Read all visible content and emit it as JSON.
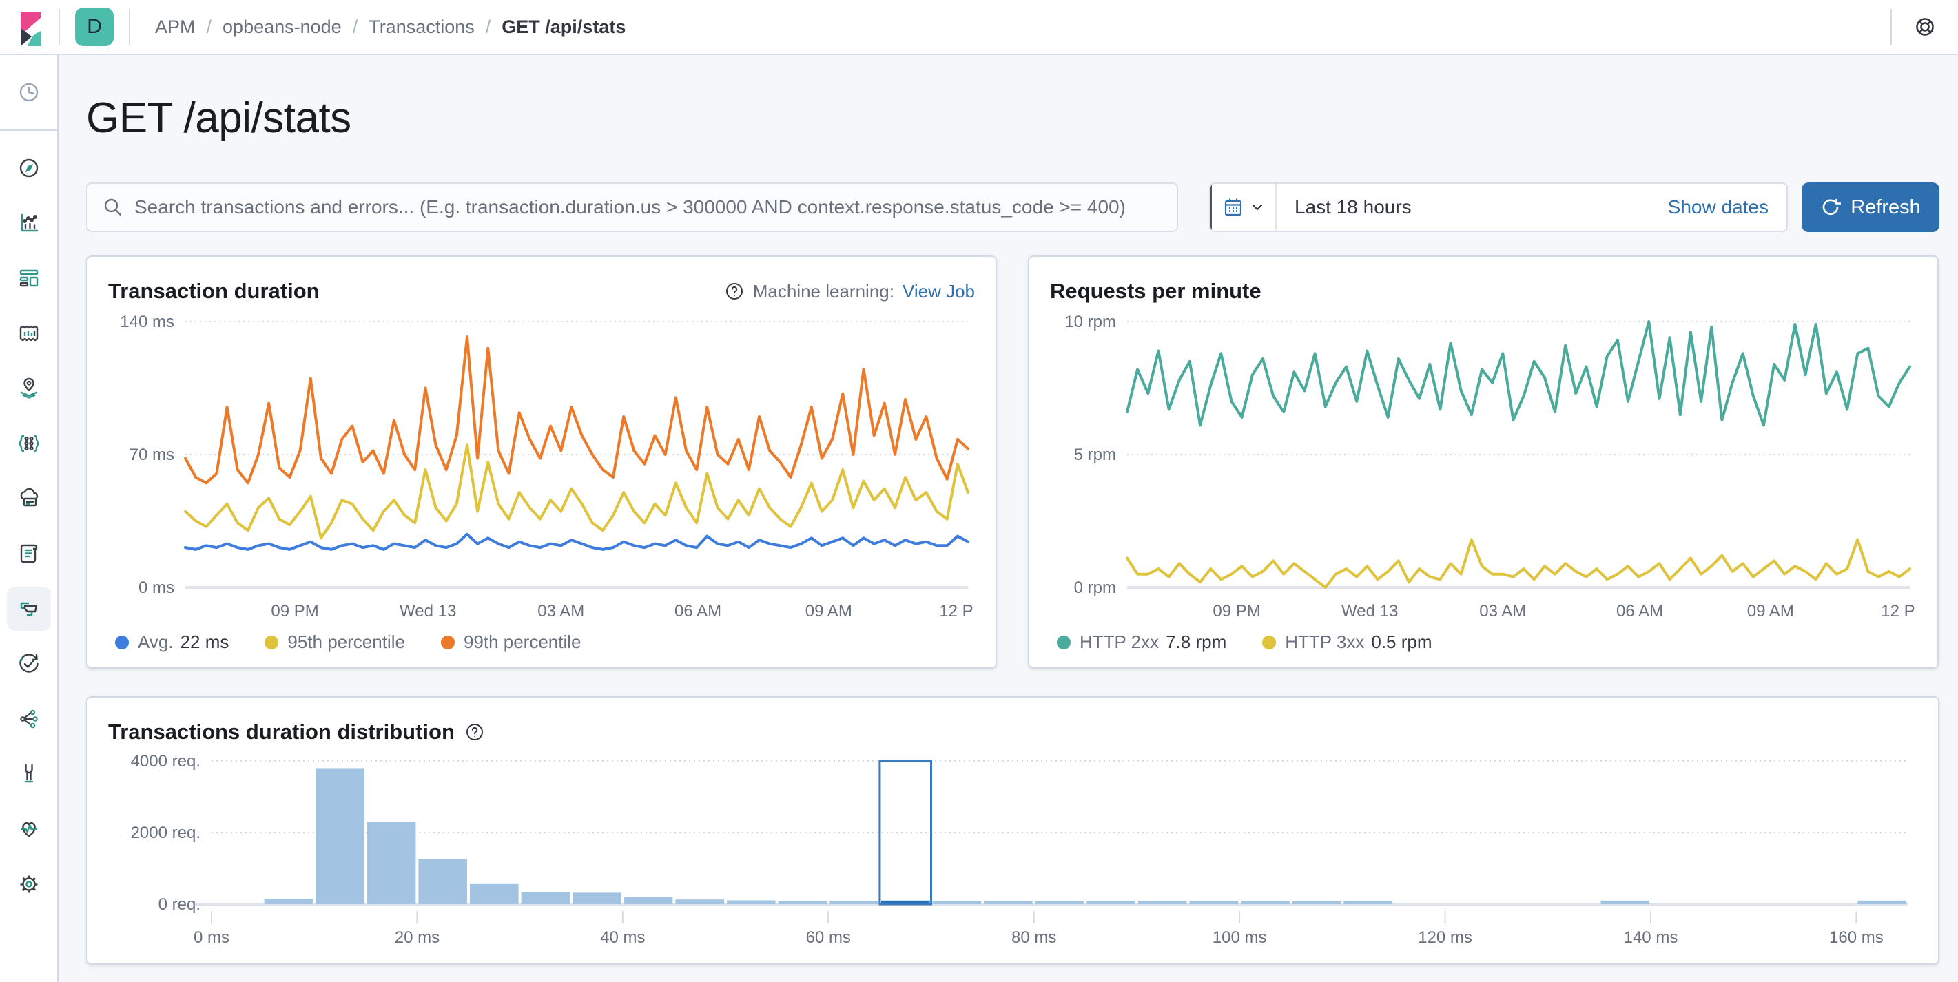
{
  "topbar": {
    "space_initial": "D",
    "breadcrumbs": [
      {
        "label": "APM"
      },
      {
        "label": "opbeans-node"
      },
      {
        "label": "Transactions"
      },
      {
        "label": "GET /api/stats"
      }
    ],
    "separator": "/"
  },
  "sidebar": {
    "items": [
      {
        "name": "recently-viewed",
        "icon": "clock"
      },
      {
        "name": "discover",
        "icon": "compass"
      },
      {
        "name": "visualize",
        "icon": "bar-line-chart"
      },
      {
        "name": "dashboard",
        "icon": "dashboard-tiles"
      },
      {
        "name": "canvas",
        "icon": "framed-chart"
      },
      {
        "name": "maps",
        "icon": "map-pin-layers"
      },
      {
        "name": "machine-learning",
        "icon": "nodes-braces"
      },
      {
        "name": "metrics",
        "icon": "cloud-server"
      },
      {
        "name": "logs",
        "icon": "scroll"
      },
      {
        "name": "apm",
        "icon": "layered-panels",
        "selected": true
      },
      {
        "name": "uptime",
        "icon": "clock-arrow-check"
      },
      {
        "name": "graph",
        "icon": "share-nodes"
      },
      {
        "name": "dev-tools",
        "icon": "wrench"
      },
      {
        "name": "monitoring",
        "icon": "heart-pulse"
      },
      {
        "name": "management",
        "icon": "gear"
      }
    ]
  },
  "page": {
    "title": "GET /api/stats"
  },
  "controls": {
    "search_placeholder": "Search transactions and errors... (E.g. transaction.duration.us > 300000 AND context.response.status_code >= 400)",
    "time_range": "Last 18 hours",
    "show_dates_label": "Show dates",
    "refresh_label": "Refresh"
  },
  "colors": {
    "accent_blue": "#2e6fb0",
    "avg_line": "#3e7dde",
    "p95_line": "#e0c33d",
    "p99_line": "#ec7a29",
    "http2xx_line": "#4aab9c",
    "http3xx_line": "#e0c33d",
    "hist_bar": "#a2c3e1",
    "hist_bar_selected": "#2a6cb8",
    "hist_selection_outline": "#3a7bc0",
    "badge_teal": "#4cbcab",
    "logo_pink": "#e8478b",
    "logo_dark": "#353a48",
    "logo_teal": "#4fc2ae"
  },
  "cards": {
    "duration": {
      "title": "Transaction duration",
      "ml_label": "Machine learning:",
      "ml_link": "View Job",
      "legend": [
        {
          "label": "Avg.",
          "value": "22 ms",
          "color": "#3e7dde"
        },
        {
          "label": "95th percentile",
          "value": "",
          "color": "#e0c33d"
        },
        {
          "label": "99th percentile",
          "value": "",
          "color": "#ec7a29"
        }
      ]
    },
    "rpm": {
      "title": "Requests per minute",
      "legend": [
        {
          "label": "HTTP 2xx",
          "value": "7.8 rpm",
          "color": "#4aab9c"
        },
        {
          "label": "HTTP 3xx",
          "value": "0.5 rpm",
          "color": "#e0c33d"
        }
      ]
    },
    "distribution": {
      "title": "Transactions duration distribution"
    }
  },
  "chart_data": [
    {
      "id": "duration",
      "type": "line",
      "title": "Transaction duration",
      "ylabel": "ms",
      "ylim": [
        0,
        140
      ],
      "grid": "dotted-horizontal",
      "yticks": [
        {
          "v": 0,
          "label": "0 ms"
        },
        {
          "v": 70,
          "label": "70 ms"
        },
        {
          "v": 140,
          "label": "140 ms"
        }
      ],
      "xticks": [
        {
          "frac": 0.14,
          "label": "09 PM"
        },
        {
          "frac": 0.31,
          "label": "Wed 13"
        },
        {
          "frac": 0.48,
          "label": "03 AM"
        },
        {
          "frac": 0.655,
          "label": "06 AM"
        },
        {
          "frac": 0.822,
          "label": "09 AM"
        },
        {
          "frac": 0.985,
          "label": "12 P"
        }
      ],
      "series": [
        {
          "name": "Avg.",
          "color": "#3e7dde",
          "values": [
            21,
            20,
            22,
            21,
            23,
            21,
            20,
            22,
            23,
            21,
            20,
            22,
            24,
            21,
            20,
            22,
            23,
            21,
            22,
            20,
            23,
            22,
            21,
            25,
            22,
            21,
            23,
            28,
            23,
            26,
            23,
            21,
            24,
            22,
            21,
            23,
            22,
            25,
            23,
            21,
            20,
            21,
            24,
            22,
            21,
            23,
            22,
            25,
            22,
            21,
            27,
            23,
            22,
            24,
            21,
            25,
            23,
            22,
            21,
            23,
            26,
            22,
            24,
            26,
            22,
            26,
            23,
            25,
            22,
            25,
            23,
            24,
            22,
            22,
            27,
            24
          ]
        },
        {
          "name": "95th percentile",
          "color": "#e0c33d",
          "values": [
            40,
            35,
            32,
            38,
            44,
            34,
            30,
            42,
            47,
            36,
            33,
            40,
            48,
            26,
            34,
            46,
            44,
            36,
            30,
            40,
            46,
            38,
            34,
            62,
            42,
            35,
            44,
            75,
            40,
            66,
            44,
            36,
            50,
            42,
            36,
            46,
            40,
            52,
            44,
            34,
            30,
            38,
            50,
            40,
            34,
            44,
            38,
            55,
            42,
            34,
            60,
            42,
            36,
            46,
            38,
            52,
            42,
            36,
            32,
            42,
            55,
            40,
            46,
            62,
            42,
            56,
            46,
            52,
            42,
            58,
            46,
            50,
            40,
            36,
            65,
            50
          ]
        },
        {
          "name": "99th percentile",
          "color": "#ec7a29",
          "values": [
            68,
            58,
            55,
            60,
            95,
            62,
            55,
            70,
            97,
            63,
            58,
            72,
            110,
            68,
            60,
            78,
            85,
            66,
            72,
            60,
            88,
            70,
            62,
            105,
            75,
            62,
            80,
            132,
            68,
            126,
            72,
            60,
            92,
            78,
            68,
            85,
            72,
            95,
            80,
            70,
            62,
            58,
            90,
            72,
            65,
            80,
            70,
            100,
            72,
            62,
            95,
            70,
            65,
            78,
            62,
            90,
            72,
            66,
            58,
            75,
            95,
            68,
            78,
            102,
            70,
            115,
            80,
            97,
            70,
            99,
            78,
            90,
            68,
            57,
            78,
            73
          ]
        }
      ]
    },
    {
      "id": "rpm",
      "type": "line",
      "title": "Requests per minute",
      "ylabel": "rpm",
      "ylim": [
        0,
        10
      ],
      "grid": "dotted-horizontal",
      "yticks": [
        {
          "v": 0,
          "label": "0 rpm"
        },
        {
          "v": 5,
          "label": "5 rpm"
        },
        {
          "v": 10,
          "label": "10 rpm"
        }
      ],
      "xticks": [
        {
          "frac": 0.14,
          "label": "09 PM"
        },
        {
          "frac": 0.31,
          "label": "Wed 13"
        },
        {
          "frac": 0.48,
          "label": "03 AM"
        },
        {
          "frac": 0.655,
          "label": "06 AM"
        },
        {
          "frac": 0.822,
          "label": "09 AM"
        },
        {
          "frac": 0.985,
          "label": "12 P"
        }
      ],
      "series": [
        {
          "name": "HTTP 2xx",
          "color": "#4aab9c",
          "values": [
            6.6,
            8.2,
            7.3,
            8.9,
            6.7,
            7.8,
            8.5,
            6.1,
            7.6,
            8.8,
            7.0,
            6.4,
            8.0,
            8.6,
            7.2,
            6.6,
            8.1,
            7.4,
            8.8,
            6.8,
            7.7,
            8.3,
            7.0,
            8.9,
            7.6,
            6.4,
            8.6,
            7.8,
            7.1,
            8.4,
            6.7,
            9.2,
            7.4,
            6.5,
            8.2,
            7.7,
            8.8,
            6.3,
            7.2,
            8.5,
            7.9,
            6.6,
            9.1,
            7.3,
            8.3,
            6.8,
            8.7,
            9.3,
            7.0,
            8.5,
            10.0,
            7.1,
            9.4,
            6.5,
            9.6,
            7.0,
            9.8,
            6.3,
            7.7,
            8.8,
            7.2,
            6.1,
            8.4,
            7.8,
            9.9,
            8.0,
            9.9,
            7.3,
            8.1,
            6.7,
            8.8,
            9.0,
            7.2,
            6.8,
            7.7,
            8.3
          ]
        },
        {
          "name": "HTTP 3xx",
          "color": "#e0c33d",
          "values": [
            1.1,
            0.5,
            0.5,
            0.7,
            0.4,
            0.9,
            0.5,
            0.2,
            0.7,
            0.3,
            0.5,
            0.8,
            0.4,
            0.6,
            1.0,
            0.5,
            0.9,
            0.6,
            0.3,
            0.0,
            0.5,
            0.7,
            0.4,
            0.8,
            0.3,
            0.6,
            1.0,
            0.2,
            0.7,
            0.4,
            0.3,
            0.9,
            0.5,
            1.8,
            0.8,
            0.5,
            0.5,
            0.4,
            0.7,
            0.3,
            0.8,
            0.5,
            0.9,
            0.6,
            0.4,
            0.7,
            0.3,
            0.5,
            0.8,
            0.4,
            0.6,
            0.9,
            0.3,
            0.7,
            1.1,
            0.5,
            0.8,
            1.2,
            0.6,
            0.9,
            0.4,
            0.7,
            1.0,
            0.5,
            0.8,
            0.6,
            0.3,
            0.9,
            0.5,
            0.7,
            1.8,
            0.6,
            0.4,
            0.6,
            0.4,
            0.7
          ]
        }
      ]
    },
    {
      "id": "distribution",
      "type": "bar",
      "title": "Transactions duration distribution",
      "ylabel": "req.",
      "ylim": [
        0,
        4000
      ],
      "x_max_ms": 165,
      "bin_width_ms": 5,
      "yticks": [
        {
          "v": 0,
          "label": "0 req."
        },
        {
          "v": 2000,
          "label": "2000 req."
        },
        {
          "v": 4000,
          "label": "4000 req."
        }
      ],
      "xticks": [
        {
          "ms": 0,
          "label": "0 ms"
        },
        {
          "ms": 20,
          "label": "20 ms"
        },
        {
          "ms": 40,
          "label": "40 ms"
        },
        {
          "ms": 60,
          "label": "60 ms"
        },
        {
          "ms": 80,
          "label": "80 ms"
        },
        {
          "ms": 100,
          "label": "100 ms"
        },
        {
          "ms": 120,
          "label": "120 ms"
        },
        {
          "ms": 140,
          "label": "140 ms"
        },
        {
          "ms": 160,
          "label": "160 ms"
        }
      ],
      "values": [
        0,
        150,
        3800,
        2300,
        1250,
        580,
        330,
        320,
        200,
        130,
        105,
        95,
        95,
        100,
        95,
        95,
        95,
        95,
        95,
        95,
        95,
        95,
        95,
        0,
        0,
        0,
        0,
        100,
        0,
        0,
        0,
        0,
        100
      ],
      "selected_bin_index": 13,
      "selected_bin_range_ms": [
        65,
        70
      ],
      "bar_color": "#a2c3e1",
      "selected_bar_color": "#2a6cb8",
      "selection_outline_color": "#3a7bc0"
    }
  ]
}
